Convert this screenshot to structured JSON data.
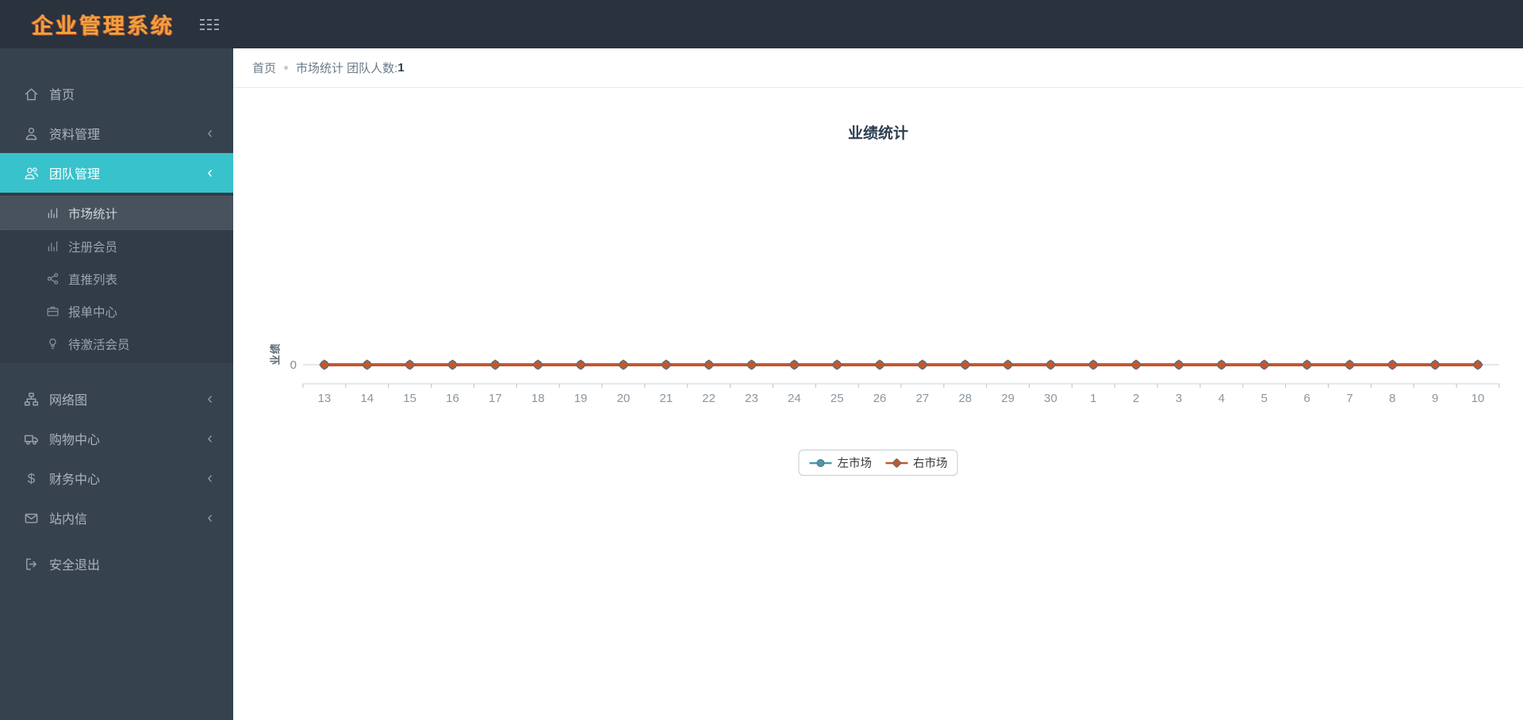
{
  "topbar": {
    "logo": "企业管理系统",
    "menu_icon": "hamburger-icon"
  },
  "breadcrumb": {
    "home": "首页",
    "current": "市场统计 团队人数:",
    "count": "1"
  },
  "sidebar": {
    "items": [
      {
        "label": "首页",
        "icon": "home-icon"
      },
      {
        "label": "资料管理",
        "icon": "user-icon",
        "chevron": "‹"
      },
      {
        "label": "团队管理",
        "icon": "users-icon",
        "chevron": "‹",
        "active": true,
        "children": [
          {
            "label": "市场统计",
            "icon": "bar-chart-icon",
            "selected": true
          },
          {
            "label": "注册会员",
            "icon": "bar-chart-icon"
          },
          {
            "label": "直推列表",
            "icon": "share-icon"
          },
          {
            "label": "报单中心",
            "icon": "briefcase-icon"
          },
          {
            "label": "待激活会员",
            "icon": "bulb-icon"
          }
        ]
      },
      {
        "label": "网络图",
        "icon": "sitemap-icon",
        "chevron": "‹"
      },
      {
        "label": "购物中心",
        "icon": "truck-icon",
        "chevron": "‹"
      },
      {
        "label": "财务中心",
        "icon": "dollar-icon",
        "chevron": "‹"
      },
      {
        "label": "站内信",
        "icon": "envelope-icon",
        "chevron": "‹"
      },
      {
        "label": "安全退出",
        "icon": "signout-icon"
      }
    ]
  },
  "chart_data": {
    "type": "line",
    "title": "业绩统计",
    "xlabel": "",
    "ylabel": "业绩",
    "y_ticks": [
      0
    ],
    "y_tick_labels": [
      "0"
    ],
    "grid": true,
    "legend_position": "bottom",
    "categories": [
      "13",
      "14",
      "15",
      "16",
      "17",
      "18",
      "19",
      "20",
      "21",
      "22",
      "23",
      "24",
      "25",
      "26",
      "27",
      "28",
      "29",
      "30",
      "1",
      "2",
      "3",
      "4",
      "5",
      "6",
      "7",
      "8",
      "9",
      "10"
    ],
    "series": [
      {
        "name": "左市场",
        "color": "#4a99a8",
        "marker": "circle",
        "values": [
          0,
          0,
          0,
          0,
          0,
          0,
          0,
          0,
          0,
          0,
          0,
          0,
          0,
          0,
          0,
          0,
          0,
          0,
          0,
          0,
          0,
          0,
          0,
          0,
          0,
          0,
          0,
          0
        ]
      },
      {
        "name": "右市场",
        "color": "#c2582f",
        "marker": "diamond",
        "values": [
          0,
          0,
          0,
          0,
          0,
          0,
          0,
          0,
          0,
          0,
          0,
          0,
          0,
          0,
          0,
          0,
          0,
          0,
          0,
          0,
          0,
          0,
          0,
          0,
          0,
          0,
          0,
          0
        ]
      }
    ]
  }
}
